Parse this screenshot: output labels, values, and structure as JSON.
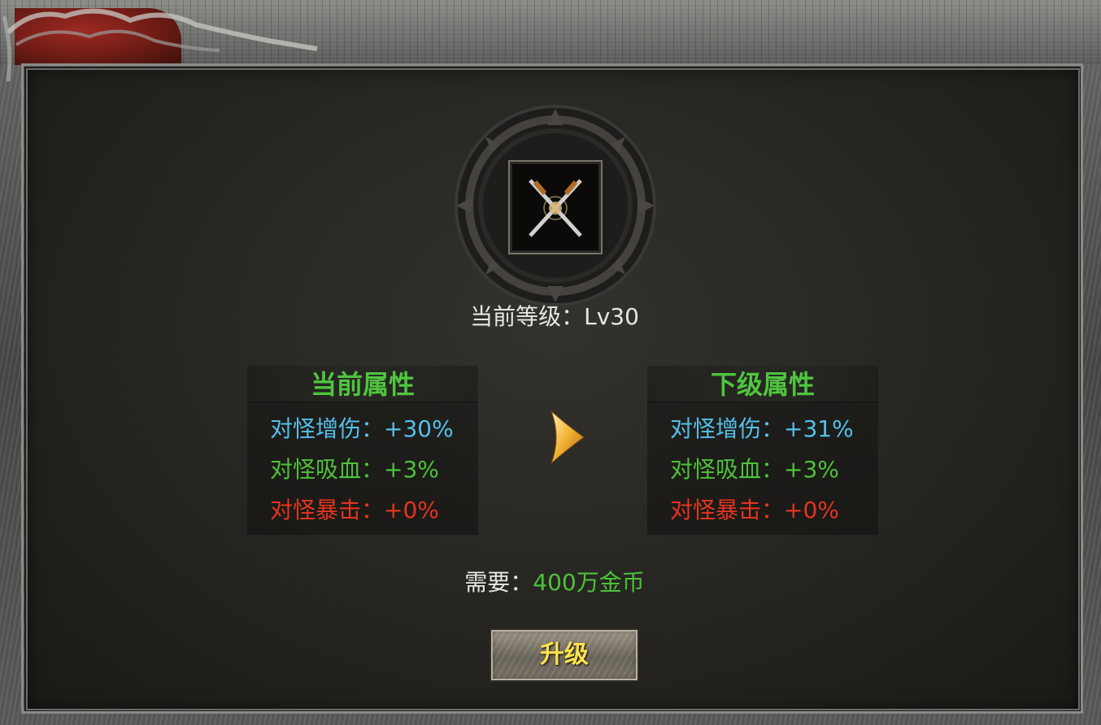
{
  "skill": {
    "icon": "crossed-swords-icon",
    "level_text": "当前等级：Lv30"
  },
  "current": {
    "title": "当前属性",
    "stats": [
      {
        "text": "对怪增伤：+30%",
        "color": "#54c0ea"
      },
      {
        "text": "对怪吸血：+3%",
        "color": "#4cc23a"
      },
      {
        "text": "对怪暴击：+0%",
        "color": "#e4341f"
      }
    ]
  },
  "next": {
    "title": "下级属性",
    "stats": [
      {
        "text": "对怪增伤：+31%",
        "color": "#54c0ea"
      },
      {
        "text": "对怪吸血：+3%",
        "color": "#4cc23a"
      },
      {
        "text": "对怪暴击：+0%",
        "color": "#e4341f"
      }
    ]
  },
  "arrow_icon": "next-arrow-icon",
  "cost": {
    "label": "需要：",
    "amount": "400万金币"
  },
  "upgrade_button": {
    "label": "升级"
  }
}
